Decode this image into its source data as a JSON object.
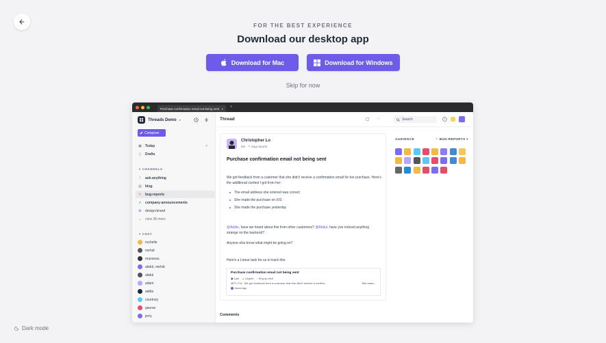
{
  "onboarding": {
    "eyebrow": "FOR THE BEST EXPERIENCE",
    "headline": "Download our desktop app",
    "download_mac": "Download for Mac",
    "download_windows": "Download for Windows",
    "skip": "Skip for now",
    "dark_mode": "Dark mode"
  },
  "window": {
    "tab_title": "Purchase confirmation email not being sent"
  },
  "sidebar": {
    "workspace": "Threads Demo",
    "compose": "Compose",
    "today": "Today",
    "today_badge": "7",
    "drafts": "Drafts",
    "channels_header": "CHANNELS",
    "channels": [
      "ask-anything",
      "blog",
      "bug-reports",
      "company-announcements",
      "design-brand"
    ],
    "view_more": "view 38 more",
    "chat_header": "CHAT",
    "chats": [
      "rochelle",
      "mehdi",
      "rousseau",
      "abdul, mehdi",
      "abdul",
      "adam",
      "addie",
      "courtney",
      "gaurav",
      "jerry"
    ]
  },
  "topbar": {
    "title": "Thread",
    "search": "Search"
  },
  "post": {
    "author": "Christopher Lo",
    "time": "5m",
    "channel": "bug-reports",
    "title": "Purchase confirmation email not being sent",
    "p1": "We got feedback from a customer that she didn't receive a confirmation email for her purchase. Here's the additional context I got from her:",
    "bullets": [
      "The email address she entered was correct",
      "She made the purchase on iOS",
      "She made the purchase yesterday"
    ],
    "p2_mention1": "@Addie",
    "p2_mid": ", have we heard about this from other customers? ",
    "p2_mention2": "@Abdul",
    "p2_end": ", have you noticed anything strange on the backend?",
    "p3": "Anyone else know what might be going on?",
    "p4": "Here's a Linear task for us to track this:",
    "linear": {
      "title": "Purchase confirmation email not being sent",
      "tag_user": "Lyle",
      "tag_priority": "Urgent",
      "tag_team": "Eng up next",
      "desc": "MPT-276 · We got feedback from a customer that she didn't receive a confirm...",
      "see_more": "See more...",
      "source": "linear.app"
    }
  },
  "comments_label": "Comments",
  "audience": {
    "header": "AUDIENCE",
    "channel": "BUG-REPORTS",
    "avatar_colors": [
      "#7c6cf0",
      "#f4b942",
      "#5ac8fa",
      "#e94b6b",
      "#f4b942",
      "#8e7cf7",
      "#3f8bd9",
      "#f7c65d",
      "#f4b942",
      "#b9a5ff",
      "#555",
      "#5ac8fa",
      "#e94b6b",
      "#7c6cf0",
      "#3f8bd9",
      "#f4b942",
      "#666",
      "#1f8bd9",
      "#f4b942",
      "#e94b6b",
      "#7c6cf0",
      "#e94b6b"
    ]
  },
  "colors": {
    "accent": "#6d5ce7",
    "background": "#f3f3f5"
  }
}
